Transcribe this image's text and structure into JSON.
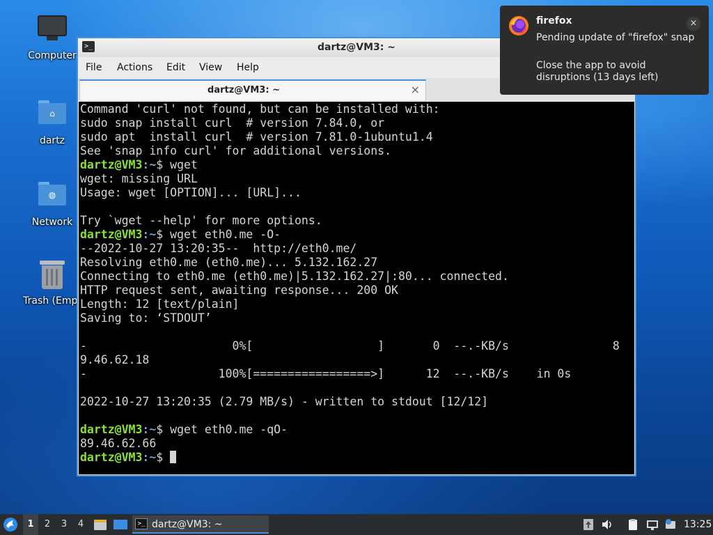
{
  "desktop": {
    "icons": [
      {
        "label": "Computer"
      },
      {
        "label": "dartz"
      },
      {
        "label": "Network"
      },
      {
        "label": "Trash (Empt"
      }
    ]
  },
  "window": {
    "title": "dartz@VM3: ~",
    "menu": [
      "File",
      "Actions",
      "Edit",
      "View",
      "Help"
    ],
    "tab_label": "dartz@VM3: ~",
    "tab_close": "×"
  },
  "terminal": {
    "prompt_user": "dartz@VM3",
    "prompt_path": ":~",
    "prompt_suffix": "$ ",
    "lines": [
      {
        "text": "Command 'curl' not found, but can be installed with:"
      },
      {
        "text": "sudo snap install curl  # version 7.84.0, or"
      },
      {
        "text": "sudo apt  install curl  # version 7.81.0-1ubuntu1.4"
      },
      {
        "text": "See 'snap info curl' for additional versions."
      },
      {
        "prompt": true,
        "cmd": "wget"
      },
      {
        "text": "wget: missing URL"
      },
      {
        "text": "Usage: wget [OPTION]... [URL]..."
      },
      {
        "text": ""
      },
      {
        "text": "Try `wget --help' for more options."
      },
      {
        "prompt": true,
        "cmd": "wget eth0.me -O-"
      },
      {
        "text": "--2022-10-27 13:20:35--  http://eth0.me/"
      },
      {
        "text": "Resolving eth0.me (eth0.me)... 5.132.162.27"
      },
      {
        "text": "Connecting to eth0.me (eth0.me)|5.132.162.27|:80... connected."
      },
      {
        "text": "HTTP request sent, awaiting response... 200 OK"
      },
      {
        "text": "Length: 12 [text/plain]"
      },
      {
        "text": "Saving to: ‘STDOUT’"
      },
      {
        "text": ""
      },
      {
        "text": "-                     0%[                  ]       0  --.-KB/s               8"
      },
      {
        "text": "9.46.62.18"
      },
      {
        "text": "-                   100%[=================>]      12  --.-KB/s    in 0s"
      },
      {
        "text": ""
      },
      {
        "text": "2022-10-27 13:20:35 (2.79 MB/s) - written to stdout [12/12]"
      },
      {
        "text": ""
      },
      {
        "prompt": true,
        "cmd": "wget eth0.me -qO-"
      },
      {
        "text": "89.46.62.66"
      },
      {
        "prompt": true,
        "cmd": "",
        "cursor": true
      }
    ]
  },
  "notification": {
    "app": "firefox",
    "message": "Pending update of \"firefox\" snap",
    "detail": "Close the app to avoid disruptions (13 days left)",
    "close": "×"
  },
  "taskbar": {
    "workspaces": [
      "1",
      "2",
      "3",
      "4"
    ],
    "active_workspace": "1",
    "task_label": "dartz@VM3: ~",
    "clock": "13:25"
  },
  "colors": {
    "prompt_user": "#8ae234",
    "prompt_path": "#729fcf",
    "terminal_fg": "#d3d7cf",
    "accent": "#4a90d9"
  }
}
